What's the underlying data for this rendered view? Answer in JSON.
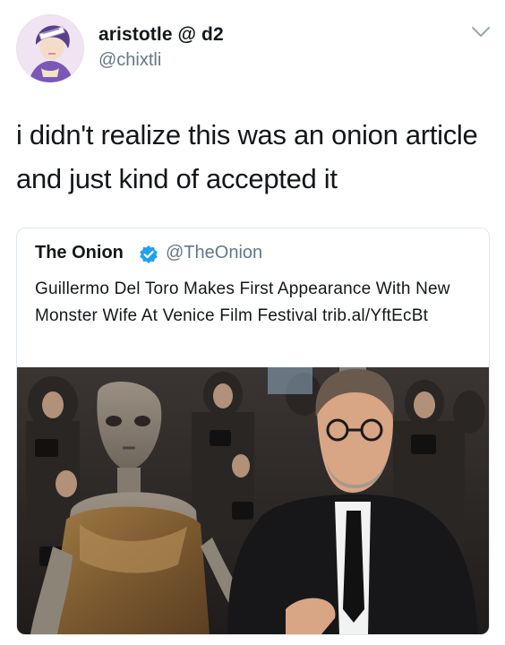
{
  "tweet": {
    "author": {
      "name": "aristotle @ d2",
      "handle": "@chixtli",
      "avatar_icon": "anime-avatar-icon"
    },
    "menu_icon": "chevron-down-icon",
    "text": "i didn't realize this was an onion article and just kind of accepted it"
  },
  "quoted_tweet": {
    "author": {
      "name": "The Onion",
      "handle": "@TheOnion",
      "verified_icon": "verified-badge-icon"
    },
    "text": "Guillermo Del Toro Makes First Appearance With New Monster Wife At Venice Film Festival trib.al/YftEcBt",
    "photo": "red-carpet-photo"
  },
  "colors": {
    "text_primary": "#14171a",
    "text_secondary": "#657786",
    "verified": "#1da1f2",
    "card_border": "#e1e8ed"
  }
}
